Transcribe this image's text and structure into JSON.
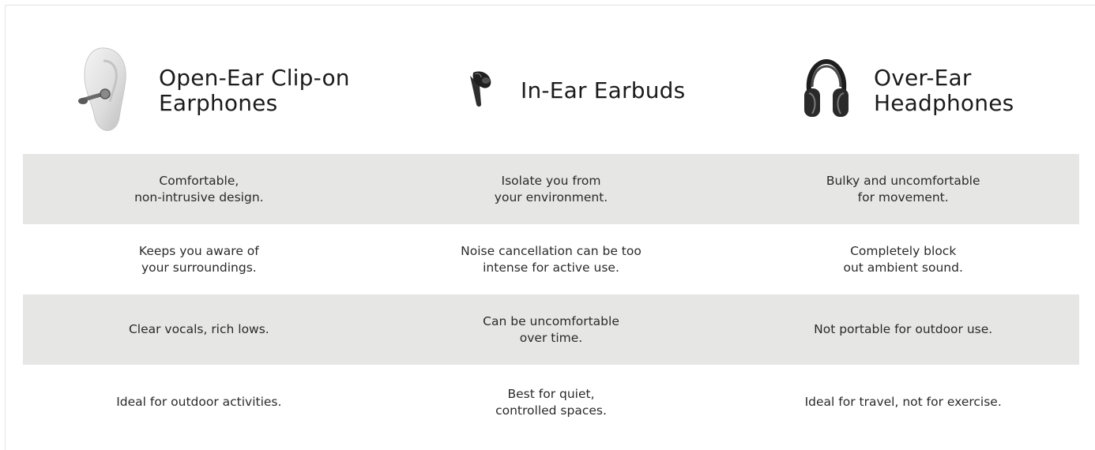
{
  "columns": [
    {
      "title": "Open-Ear Clip-on\nEarphones",
      "icon": "open-ear-clip-earphone-icon"
    },
    {
      "title": "In-Ear Earbuds",
      "icon": "in-ear-earbud-icon"
    },
    {
      "title": "Over-Ear\nHeadphones",
      "icon": "over-ear-headphones-icon"
    }
  ],
  "rows": [
    [
      "Comfortable,\nnon-intrusive design.",
      "Isolate you from\nyour environment.",
      "Bulky and uncomfortable\nfor movement."
    ],
    [
      "Keeps you aware of\nyour surroundings.",
      "Noise cancellation can be too\nintense for active use.",
      "Completely block\nout ambient sound."
    ],
    [
      "Clear vocals, rich lows.",
      "Can be uncomfortable\nover time.",
      "Not portable for outdoor use."
    ],
    [
      "Ideal for outdoor activities.",
      "Best for quiet,\ncontrolled spaces.",
      "Ideal for travel, not for exercise."
    ]
  ],
  "colors": {
    "shaded_row": "#e6e6e5",
    "text": "#2a2a2a",
    "background": "#ffffff"
  }
}
